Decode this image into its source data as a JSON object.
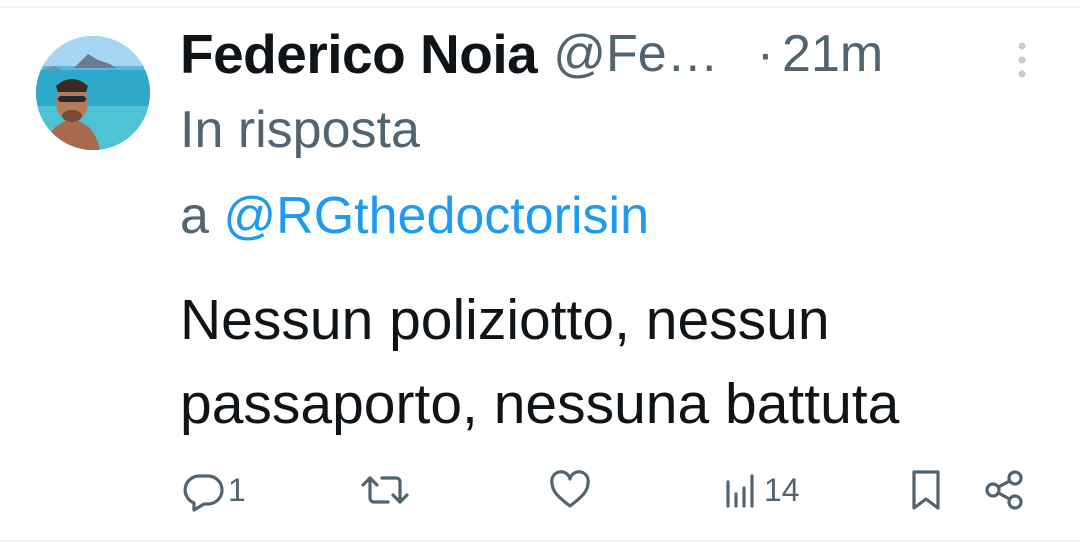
{
  "tweet": {
    "display_name": "Federico Noia",
    "handle": "@Fe…",
    "separator": "·",
    "time": "21m",
    "reply_prefix_line1": "In risposta",
    "reply_prefix_line2": "a ",
    "reply_handle": "@RGthedoctorisin",
    "text": "Nessun poliziotto, nessun passaporto, nessuna battuta"
  },
  "actions": {
    "reply_count": "1",
    "views_count": "14"
  },
  "icons": {
    "more": "more-vertical-icon",
    "reply": "reply-bubble-icon",
    "retweet": "retweet-icon",
    "like": "heart-icon",
    "views": "views-bar-icon",
    "bookmark": "bookmark-icon",
    "share": "share-icon"
  },
  "colors": {
    "text_primary": "#0f1419",
    "text_secondary": "#536471",
    "accent": "#1d9bf0"
  }
}
